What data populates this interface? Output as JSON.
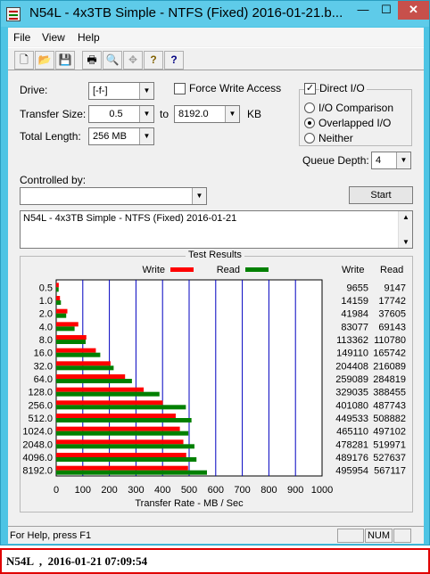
{
  "window": {
    "title": "N54L - 4x3TB Simple - NTFS (Fixed) 2016-01-21.b...",
    "controls": {
      "minimize": "—",
      "maximize": "☐",
      "close": "✕"
    }
  },
  "menu": [
    "File",
    "View",
    "Help"
  ],
  "toolbar": {
    "icons": [
      "new-icon",
      "open-icon",
      "save-icon",
      "print-icon",
      "print-preview-icon",
      "move-icon",
      "help-icon",
      "context-help-icon"
    ],
    "glyphs": [
      "🗋",
      "📂",
      "💾",
      "🖶",
      "🔍",
      "✥",
      "?",
      "?"
    ]
  },
  "form": {
    "drive_label": "Drive:",
    "drive_value": "[-f-]",
    "force_write_label": "Force Write Access",
    "direct_io_label": "Direct I/O",
    "direct_io_checked": "✓",
    "transfer_size_label": "Transfer Size:",
    "transfer_from": "0.5",
    "to_label": "to",
    "transfer_to": "8192.0",
    "kb_label": "KB",
    "total_length_label": "Total Length:",
    "total_length_value": "256 MB",
    "io_comparison_label": "I/O Comparison",
    "overlapped_io_label": "Overlapped I/O",
    "neither_label": "Neither",
    "queue_depth_label": "Queue Depth:",
    "queue_depth_value": "4",
    "controlled_by_label": "Controlled by:",
    "controlled_by_value": "",
    "start_label": "Start",
    "description": "N54L - 4x3TB Simple - NTFS (Fixed) 2016-01-21"
  },
  "results": {
    "title": "Test Results",
    "write_label": "Write",
    "read_label": "Read",
    "col_write": "Write",
    "col_read": "Read",
    "rows": [
      {
        "size": "0.5",
        "write": "9655",
        "read": "9147"
      },
      {
        "size": "1.0",
        "write": "14159",
        "read": "17742"
      },
      {
        "size": "2.0",
        "write": "41984",
        "read": "37605"
      },
      {
        "size": "4.0",
        "write": "83077",
        "read": "69143"
      },
      {
        "size": "8.0",
        "write": "113362",
        "read": "110780"
      },
      {
        "size": "16.0",
        "write": "149110",
        "read": "165742"
      },
      {
        "size": "32.0",
        "write": "204408",
        "read": "216089"
      },
      {
        "size": "64.0",
        "write": "259089",
        "read": "284819"
      },
      {
        "size": "128.0",
        "write": "329035",
        "read": "388455"
      },
      {
        "size": "256.0",
        "write": "401080",
        "read": "487743"
      },
      {
        "size": "512.0",
        "write": "449533",
        "read": "508882"
      },
      {
        "size": "1024.0",
        "write": "465110",
        "read": "497102"
      },
      {
        "size": "2048.0",
        "write": "478281",
        "read": "519971"
      },
      {
        "size": "4096.0",
        "write": "489176",
        "read": "527637"
      },
      {
        "size": "8192.0",
        "write": "495954",
        "read": "567117"
      }
    ]
  },
  "chart_data": {
    "type": "bar",
    "orientation": "horizontal",
    "categories": [
      "0.5",
      "1.0",
      "2.0",
      "4.0",
      "8.0",
      "16.0",
      "32.0",
      "64.0",
      "128.0",
      "256.0",
      "512.0",
      "1024.0",
      "2048.0",
      "4096.0",
      "8192.0"
    ],
    "series": [
      {
        "name": "Write",
        "color": "#ff0000",
        "values": [
          9.655,
          14.159,
          41.984,
          83.077,
          113.362,
          149.11,
          204.408,
          259.089,
          329.035,
          401.08,
          449.533,
          465.11,
          478.281,
          489.176,
          495.954
        ]
      },
      {
        "name": "Read",
        "color": "#008000",
        "values": [
          9.147,
          17.742,
          37.605,
          69.143,
          110.78,
          165.742,
          216.089,
          284.819,
          388.455,
          487.743,
          508.882,
          497.102,
          519.971,
          527.637,
          567.117
        ]
      }
    ],
    "xlabel": "Transfer Rate - MB / Sec",
    "xlim": [
      0,
      1000
    ],
    "xticks": [
      "0",
      "100",
      "200",
      "300",
      "400",
      "500",
      "600",
      "700",
      "800",
      "900",
      "1000"
    ],
    "grid": true,
    "grid_color": "#0000c0",
    "legend": "top"
  },
  "statusbar": {
    "help_text": "For Help, press F1",
    "num": "NUM"
  },
  "footer": {
    "text": "N54L  ,  2016-01-21 07:09:54",
    "border_color": "#e00000"
  }
}
